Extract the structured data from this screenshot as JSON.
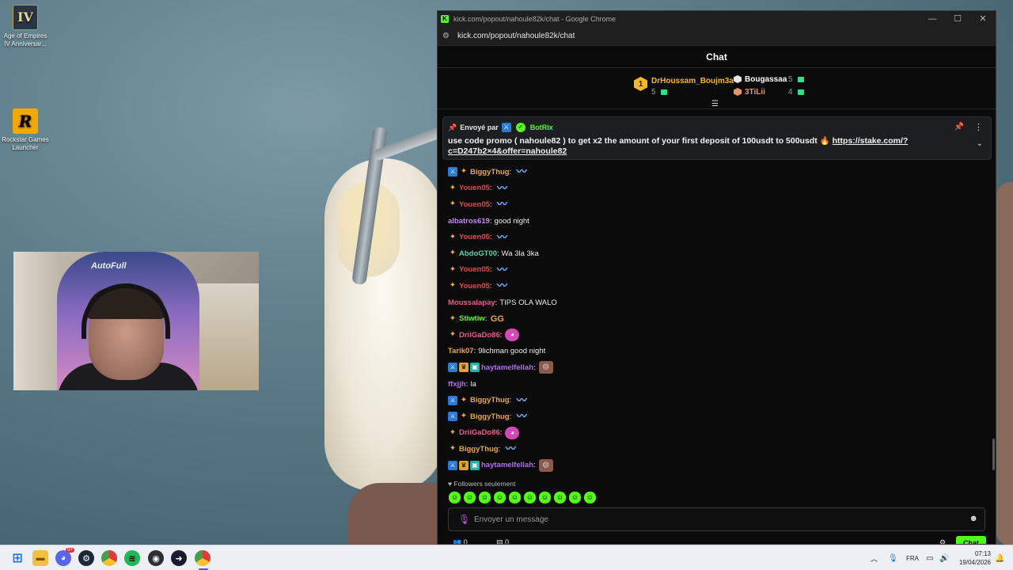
{
  "desktop": {
    "icons": [
      {
        "label_line1": "Age of Empires",
        "label_line2": "IV Anniversar...",
        "glyph": "IV"
      },
      {
        "label_line1": "Rockstar Games",
        "label_line2": "Launcher",
        "glyph": "R"
      }
    ]
  },
  "webcam": {
    "chair_logo": "AutoFull"
  },
  "browser": {
    "window_title": "kick.com/popout/nahoule82k/chat - Google Chrome",
    "favicon": "K",
    "url": "kick.com/popout/nahoule82k/chat"
  },
  "chat": {
    "header_title": "Chat",
    "leaderboard": [
      {
        "rank": "1",
        "name": "DrHoussam_Boujm3a",
        "count": "5",
        "color": "#f5b72b"
      },
      {
        "rank": "2",
        "name": "Bougassaa",
        "count": "5",
        "color": "#ffffff"
      },
      {
        "rank": "3",
        "name": "3TiLii",
        "count": "4",
        "color": "#e7956a"
      }
    ],
    "pinned": {
      "sent_by_label": "Envoyé par",
      "bot_name": "BotRix",
      "message": "use code promo ( nahoule82 ) to get x2 the amount of your first deposit of 100usdt to 500usdt 🔥",
      "link": "https://stake.com/?c=D247b2×4&offer=nahoule82"
    },
    "messages": [
      {
        "badges": [
          "mod",
          "sub"
        ],
        "user": "BiggyThug",
        "color": "#e9a93c",
        "text": "",
        "emote": "wave"
      },
      {
        "badges": [
          "sub"
        ],
        "user": "Youen05",
        "color": "#e04848",
        "text": "",
        "emote": "wave"
      },
      {
        "badges": [
          "sub"
        ],
        "user": "Youen05",
        "color": "#e04848",
        "text": "",
        "emote": "wave"
      },
      {
        "badges": [],
        "user": "albatros619",
        "color": "#c48cf0",
        "text": "good night",
        "emote": ""
      },
      {
        "badges": [
          "sub"
        ],
        "user": "Youen05",
        "color": "#e04848",
        "text": "",
        "emote": "wave"
      },
      {
        "badges": [
          "sub"
        ],
        "user": "AbdoGT00",
        "color": "#4fd6a3",
        "text": "Wa 3la 3ka",
        "emote": ""
      },
      {
        "badges": [
          "sub"
        ],
        "user": "Youen05",
        "color": "#e04848",
        "text": "",
        "emote": "wave"
      },
      {
        "badges": [
          "sub"
        ],
        "user": "Youen05",
        "color": "#e04848",
        "text": "",
        "emote": "wave"
      },
      {
        "badges": [],
        "user": "Moussalapay",
        "color": "#e95c8a",
        "text": "TIPS OLA WALO",
        "emote": ""
      },
      {
        "badges": [
          "sub"
        ],
        "user": "Stiwtiw",
        "color": "#53fc18",
        "text": "",
        "emote": "gg"
      },
      {
        "badges": [
          "sub"
        ],
        "user": "DriiGaDo86",
        "color": "#e95c8a",
        "text": "",
        "emote": "pink"
      },
      {
        "badges": [],
        "user": "Tarik07",
        "color": "#e9a93c",
        "text": "9lichman good night",
        "emote": ""
      },
      {
        "badges": [
          "mod",
          "crown",
          "gift"
        ],
        "user": "haytamelfellah",
        "color": "#b46cf0",
        "text": "",
        "emote": "face"
      },
      {
        "badges": [],
        "user": "ffxjjh",
        "color": "#b46cf0",
        "text": "la",
        "emote": ""
      },
      {
        "badges": [
          "mod",
          "sub"
        ],
        "user": "BiggyThug",
        "color": "#e9a93c",
        "text": "",
        "emote": "wave"
      },
      {
        "badges": [
          "mod",
          "sub"
        ],
        "user": "BiggyThug",
        "color": "#e9a93c",
        "text": "",
        "emote": "wave"
      },
      {
        "badges": [
          "sub"
        ],
        "user": "DriiGaDo86",
        "color": "#e95c8a",
        "text": "",
        "emote": "pink"
      },
      {
        "badges": [
          "sub"
        ],
        "user": "BiggyThug",
        "color": "#e9a93c",
        "text": "",
        "emote": "wave"
      },
      {
        "badges": [
          "mod",
          "crown",
          "gift"
        ],
        "user": "haytamelfellah",
        "color": "#b46cf0",
        "text": "",
        "emote": "face"
      }
    ],
    "followers_only": "Followers seulement",
    "input_placeholder": "Envoyer un message",
    "footer": {
      "viewers": "0",
      "count": "0",
      "send_label": "Chat"
    }
  },
  "taskbar": {
    "discord_badge": "9+",
    "language": "FRA",
    "time": "07:13",
    "date": "19/04/2026"
  }
}
